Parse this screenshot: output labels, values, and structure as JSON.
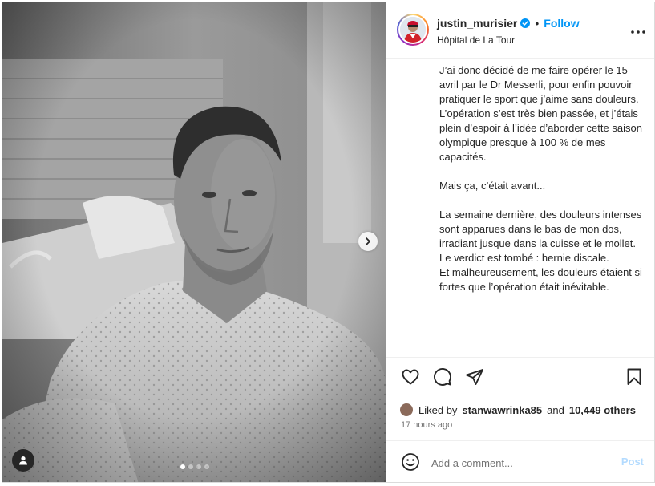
{
  "post": {
    "username": "justin_murisier",
    "follow_label": "Follow",
    "separator": "•",
    "location": "Hôpital de La Tour",
    "caption_lines": [
      "J’ai donc décidé de me faire opérer le 15 avril par le Dr Messerli, pour enfin pouvoir pratiquer le sport que j’aime sans douleurs.",
      "L’opération s’est très bien passée, et j’étais plein d’espoir à l’idée d’aborder cette saison olympique presque à 100 % de mes capacités.",
      "",
      "Mais ça, c’était avant...",
      "",
      "La semaine dernière, des douleurs intenses sont apparues dans le bas de mon dos, irradiant jusque dans la cuisse et le mollet.",
      "Le verdict est tombé : hernie discale.",
      "Et malheureusement, les douleurs étaient si fortes que l’opération était inévitable."
    ],
    "likes": {
      "prefix": "Liked by",
      "user": "stanwawrinka85",
      "connector": "and",
      "others": "10,449 others"
    },
    "timestamp": "17 hours ago",
    "comment": {
      "placeholder": "Add a comment...",
      "value": "",
      "post_label": "Post"
    },
    "carousel": {
      "slide_count": 4,
      "active_index": 0
    }
  },
  "icons": {
    "verified": "verified-badge-icon",
    "more": "more-options-icon",
    "like": "heart-icon",
    "comment": "comment-bubble-icon",
    "share": "paper-plane-icon",
    "save": "bookmark-icon",
    "emoji": "emoji-icon",
    "next": "chevron-right-icon",
    "tag": "user-tag-icon"
  },
  "colors": {
    "accent": "#0095f6",
    "post_disabled": "#b3dbff",
    "text": "#262626",
    "muted": "#737373",
    "border": "#efefef"
  }
}
